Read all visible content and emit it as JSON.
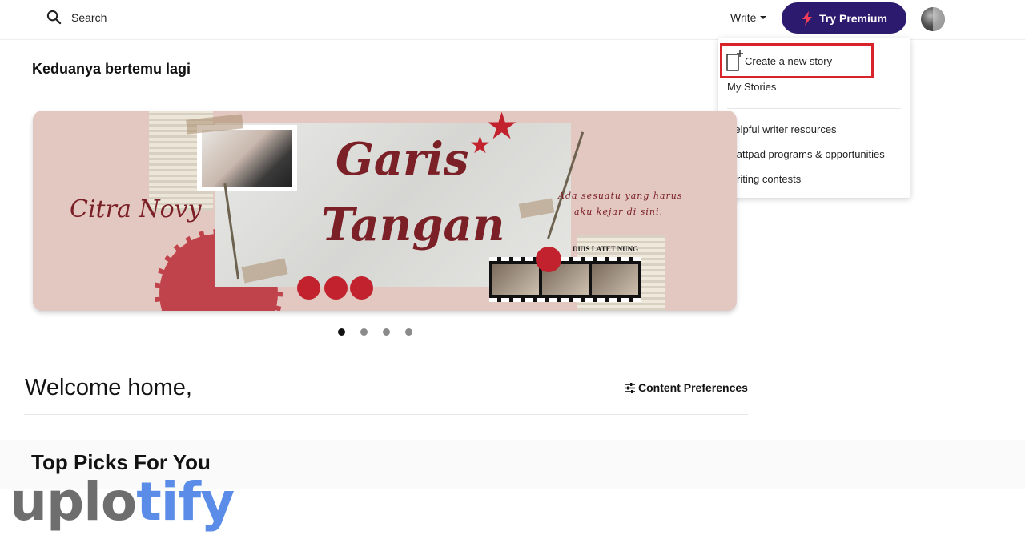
{
  "header": {
    "search_label": "Search",
    "write_label": "Write",
    "premium_label": "Try Premium",
    "premium_color": "#2c1a6e"
  },
  "write_menu": {
    "create_label": "Create a new story",
    "my_stories_label": "My Stories",
    "items": [
      "Helpful writer resources",
      "Wattpad programs & opportunities",
      "Writing contests"
    ],
    "highlight_color": "#d8232a"
  },
  "featured": {
    "story_title": "Keduanya bertemu lagi",
    "banner": {
      "title_line1": "Garis",
      "title_line2": "Tangan",
      "author": "Citra Novy",
      "tagline_line1": "Ada sesuatu yang harus",
      "tagline_line2": "aku kejar di sini.",
      "news_headline": "DUIS LATET NUNG"
    },
    "carousel": {
      "count": 4,
      "active_index": 1
    }
  },
  "home": {
    "welcome_text": "Welcome home,",
    "content_prefs_label": "Content Preferences",
    "top_picks_title": "Top Picks For You"
  },
  "watermark": {
    "part1": "uplo",
    "part2": "tify"
  },
  "icons": {
    "search": "search-icon",
    "premium": "lightning-icon",
    "create": "new-story-icon",
    "prefs": "sliders-icon"
  }
}
